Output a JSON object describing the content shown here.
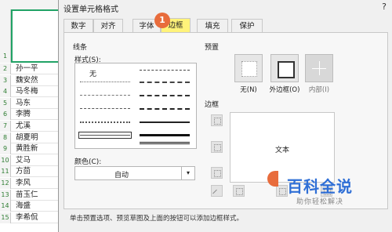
{
  "sheet": {
    "row1_num": "1",
    "rows": [
      {
        "num": "2",
        "name": "孙一平"
      },
      {
        "num": "3",
        "name": "魏安然"
      },
      {
        "num": "4",
        "name": "马冬梅"
      },
      {
        "num": "5",
        "name": "马东"
      },
      {
        "num": "6",
        "name": "李腾"
      },
      {
        "num": "7",
        "name": "尤溪"
      },
      {
        "num": "8",
        "name": "胡夏明"
      },
      {
        "num": "9",
        "name": "黄胜新"
      },
      {
        "num": "10",
        "name": "艾马"
      },
      {
        "num": "11",
        "name": "方茴"
      },
      {
        "num": "12",
        "name": "李风"
      },
      {
        "num": "13",
        "name": "苗玉仁"
      },
      {
        "num": "14",
        "name": "海盛"
      },
      {
        "num": "15",
        "name": "李希侃"
      }
    ]
  },
  "dialog": {
    "title": "设置单元格格式",
    "help": "?",
    "tabs": [
      "数字",
      "对齐",
      "字体",
      "边框",
      "填充",
      "保护"
    ],
    "active_tab": "边框",
    "line_group": "线条",
    "style_label": "样式(S):",
    "none_label": "无",
    "color_label": "颜色(C):",
    "color_value": "自动",
    "presets_label": "预置",
    "preset_none": "无(N)",
    "preset_outline": "外边框(O)",
    "preset_inside": "内部(I)",
    "border_label": "边框",
    "preview_text": "文本",
    "hint": "单击预置选项、预览草图及上面的按钮可以添加边框样式。"
  },
  "annotation": {
    "step": "1"
  },
  "watermark": {
    "logo": "百科全说",
    "subtitle": "助你轻松解决"
  },
  "colors": {
    "active_tab": "#fff37a",
    "badge": "#e86c3c",
    "watermark": "#2f6fd6",
    "sheet_select": "#21a366"
  }
}
